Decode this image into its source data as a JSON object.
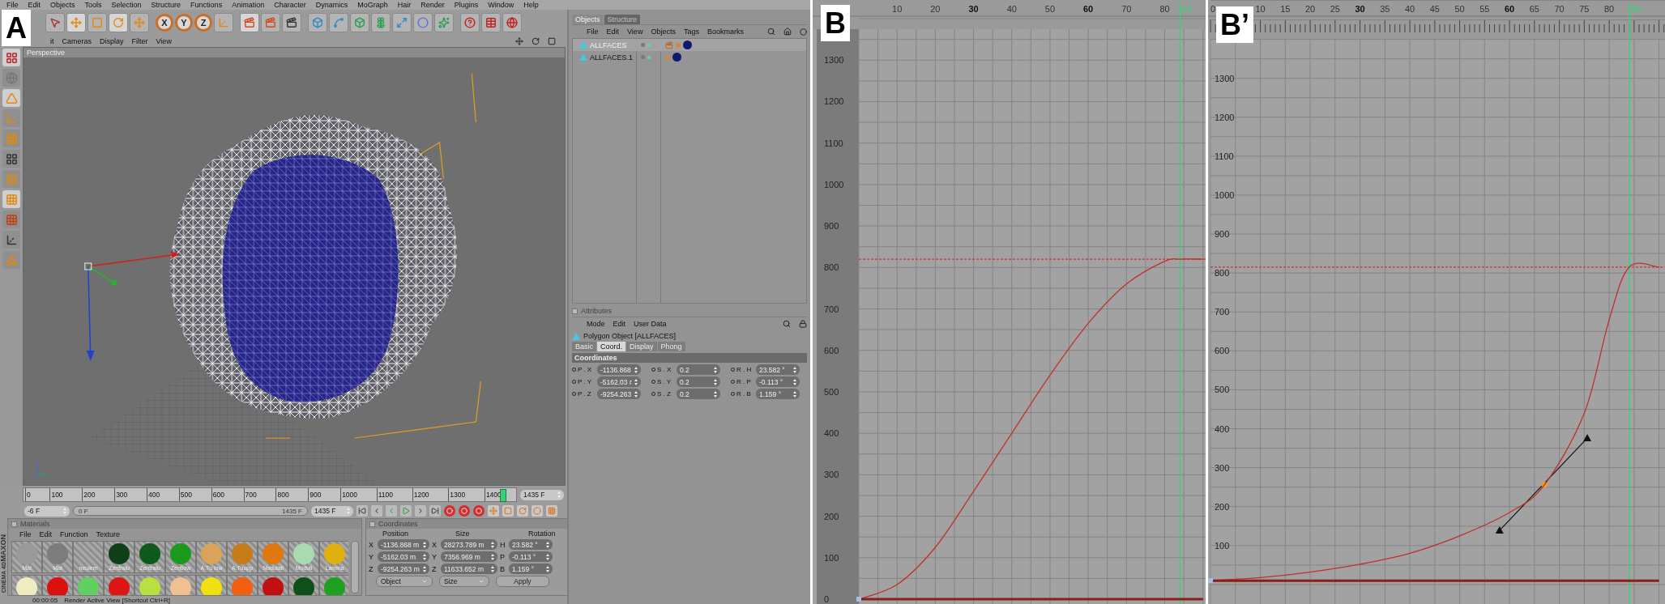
{
  "panel_a": {
    "label": "A",
    "menu": [
      "File",
      "Edit",
      "Objects",
      "Tools",
      "Selection",
      "Structure",
      "Functions",
      "Animation",
      "Character",
      "Dynamics",
      "MoGraph",
      "Hair",
      "Render",
      "Plugins",
      "Window",
      "Help"
    ],
    "axis_buttons": [
      "X",
      "Y",
      "Z"
    ],
    "viewport_menu": [
      "it",
      "Cameras",
      "Display",
      "Filter",
      "View"
    ],
    "viewport_title": "Perspective",
    "object_tabs": [
      {
        "label": "Objects",
        "selected": true
      },
      {
        "label": "Structure",
        "selected": false
      }
    ],
    "object_menu": [
      "File",
      "Edit",
      "View",
      "Objects",
      "Tags",
      "Bookmarks"
    ],
    "objects": [
      {
        "name": "ALLFACES",
        "selected": true
      },
      {
        "name": "ALLFACES.1",
        "selected": false
      }
    ],
    "attributes": {
      "title": "Attributes",
      "menu": [
        "Mode",
        "Edit",
        "User Data"
      ],
      "object": "Polygon Object [ALLFACES]",
      "tabs": [
        {
          "label": "Basic",
          "selected": false
        },
        {
          "label": "Coord.",
          "selected": true
        },
        {
          "label": "Display",
          "selected": false
        },
        {
          "label": "Phong",
          "selected": false
        }
      ],
      "section": "Coordinates",
      "rows": [
        [
          {
            "label": "P . X",
            "value": "-1136.868"
          },
          {
            "label": "S . X",
            "value": "0.2"
          },
          {
            "label": "R . H",
            "value": "23.582 °"
          }
        ],
        [
          {
            "label": "P . Y",
            "value": "-5162.03 r"
          },
          {
            "label": "S . Y",
            "value": "0.2"
          },
          {
            "label": "R . P",
            "value": "-0.113 °"
          }
        ],
        [
          {
            "label": "P . Z",
            "value": "-9254.263"
          },
          {
            "label": "S . Z",
            "value": "0.2"
          },
          {
            "label": "R . B",
            "value": "1.159 °"
          }
        ]
      ]
    },
    "timeline": {
      "ticks": [
        "0",
        "100",
        "200",
        "300",
        "400",
        "500",
        "600",
        "700",
        "800",
        "900",
        "1000",
        "1100",
        "1200",
        "1300",
        "1400"
      ],
      "level": 0.99,
      "current": "1435 F"
    },
    "controls": {
      "start": "-6 F",
      "range_start": "0 F",
      "range_end": "1435 F",
      "level": 1,
      "end": "1435 F"
    },
    "materials": {
      "title": "Materials",
      "menu": [
        "File",
        "Edit",
        "Function",
        "Texture"
      ],
      "items": [
        {
          "name": "Mat",
          "kind": "sphere",
          "color": "#9a9a9a"
        },
        {
          "name": "Mat",
          "kind": "sphere",
          "color": "#7c7c7c"
        },
        {
          "name": "neulem",
          "kind": "pattern"
        },
        {
          "name": "Zentralu",
          "kind": "sphere",
          "color": "#0f3f17"
        },
        {
          "name": "Zentralu",
          "kind": "sphere",
          "color": "#0e5a1c"
        },
        {
          "name": "Zentlow",
          "kind": "sphere",
          "color": "#1c9a1c"
        },
        {
          "name": "A.Tu low",
          "kind": "sphere",
          "color": "#d9a45a"
        },
        {
          "name": "A.Tuupp",
          "kind": "sphere",
          "color": "#c77c1a"
        },
        {
          "name": "Nodulatl",
          "kind": "sphere",
          "color": "#e07810"
        },
        {
          "name": "Moduli",
          "kind": "sphere",
          "color": "#a8dcb0"
        },
        {
          "name": "Lamina",
          "kind": "sphere",
          "color": "#e0b010"
        }
      ],
      "row_2": [
        {
          "color": "#eeecc0"
        },
        {
          "color": "#dd1010"
        },
        {
          "color": "#60d060"
        },
        {
          "color": "#dd1515"
        },
        {
          "color": "#b8e040"
        },
        {
          "color": "#f0c090"
        },
        {
          "color": "#f0e010"
        },
        {
          "color": "#f06010"
        },
        {
          "color": "#c01010"
        },
        {
          "color": "#0f4f1a"
        },
        {
          "color": "#20a020"
        }
      ]
    },
    "coordinates": {
      "title": "Coordinates",
      "headers": [
        "Position",
        "Size",
        "Rotation"
      ],
      "rows": [
        [
          {
            "axis": "X",
            "value": "-1136.868 m"
          },
          {
            "axis": "X",
            "value": "28273.789 m"
          },
          {
            "axis": "H",
            "value": "23.582 °"
          }
        ],
        [
          {
            "axis": "Y",
            "value": "-5162.03 m"
          },
          {
            "axis": "Y",
            "value": "7356.969 m"
          },
          {
            "axis": "P",
            "value": "-0.113 °"
          }
        ],
        [
          {
            "axis": "Z",
            "value": "-9254.263 m"
          },
          {
            "axis": "Z",
            "value": "11633.652 m"
          },
          {
            "axis": "B",
            "value": "1.159 °"
          }
        ]
      ],
      "dropdowns": [
        "Object",
        "Size"
      ],
      "apply": "Apply"
    },
    "brand": [
      "MAXON",
      "CINEMA 4D"
    ],
    "status": {
      "time": "00:00:05",
      "message": "Render Active View [Shortcut Ctrl+R]"
    }
  },
  "panel_b": {
    "label": "B",
    "chart_data": {
      "type": "line",
      "x": [
        0,
        10,
        20,
        30,
        40,
        50,
        60,
        70,
        80,
        84,
        90
      ],
      "series": [
        {
          "color": "#c0302c",
          "values": [
            0,
            35,
            125,
            260,
            400,
            540,
            665,
            760,
            815,
            820,
            820
          ]
        },
        {
          "color": "#8a1e1a",
          "values": [
            0,
            0,
            0,
            0,
            0,
            0,
            0,
            0,
            0,
            0,
            0
          ]
        }
      ],
      "xlim": [
        -12.08,
        90.7
      ],
      "ylim": [
        -11.7,
        1445
      ],
      "grid": true,
      "xticks": [
        10,
        20,
        30,
        40,
        50,
        60,
        70,
        80
      ],
      "yticks": [
        0,
        100,
        200,
        300,
        400,
        500,
        600,
        700,
        800,
        900,
        1000,
        1100,
        1200,
        1300
      ],
      "ref_lines": [
        {
          "axis": "y",
          "value": 820,
          "color": "#d03030"
        },
        {
          "axis": "x",
          "value": 84,
          "label": "84",
          "color": "#3ad07a"
        }
      ]
    }
  },
  "panel_b2": {
    "label": "B’",
    "chart_data": {
      "type": "line",
      "x": [
        0,
        10,
        20,
        30,
        40,
        50,
        60,
        67,
        75,
        80,
        84,
        90
      ],
      "series": [
        {
          "color": "#c0302c",
          "values": [
            10,
            18,
            32,
            52,
            80,
            125,
            185,
            256,
            440,
            680,
            815,
            815
          ]
        },
        {
          "color": "#8a1e1a",
          "values": [
            10,
            10,
            10,
            10,
            10,
            10,
            10,
            10,
            10,
            10,
            10,
            10
          ]
        }
      ],
      "xlim": [
        -0.5,
        91.2
      ],
      "ylim": [
        -50,
        1501
      ],
      "grid": true,
      "xticks": [
        0,
        10,
        15,
        20,
        25,
        30,
        35,
        40,
        45,
        50,
        55,
        60,
        65,
        70,
        75,
        80
      ],
      "yticks": [
        100,
        200,
        300,
        400,
        500,
        600,
        700,
        800,
        900,
        1000,
        1100,
        1200,
        1300
      ],
      "ref_lines": [
        {
          "axis": "y",
          "value": 815,
          "color": "#d03030"
        },
        {
          "axis": "x",
          "value": 84,
          "label": "84",
          "color": "#3ad07a"
        }
      ]
    }
  }
}
